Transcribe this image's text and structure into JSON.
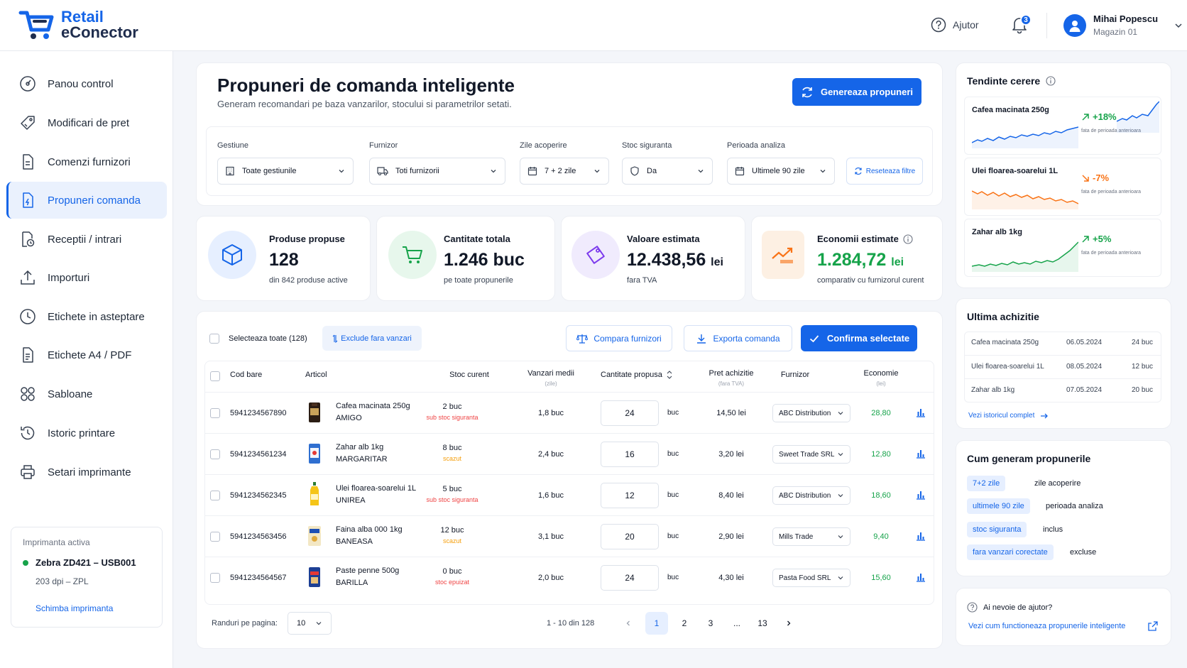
{
  "app": {
    "name_line1": "Retail",
    "name_line2": "eConector"
  },
  "header": {
    "help_label": "Ajutor",
    "notifications_count": "3",
    "user_name": "Mihai Popescu",
    "user_store": "Magazin 01"
  },
  "sidebar": {
    "items": [
      {
        "label": "Panou control",
        "icon": "dashboard-icon"
      },
      {
        "label": "Modificari de pret",
        "icon": "tag-edit-icon"
      },
      {
        "label": "Comenzi furnizori",
        "icon": "document-icon"
      },
      {
        "label": "Propuneri comanda",
        "icon": "document-bolt-icon",
        "active": true
      },
      {
        "label": "Receptii / intrari",
        "icon": "receipt-icon"
      },
      {
        "label": "Importuri",
        "icon": "upload-icon"
      },
      {
        "label": "Etichete in asteptare",
        "icon": "clock-icon"
      },
      {
        "label": "Etichete A4 / PDF",
        "icon": "file-icon"
      },
      {
        "label": "Sabloane",
        "icon": "grid-icon"
      },
      {
        "label": "Istoric printare",
        "icon": "history-icon"
      },
      {
        "label": "Setari imprimante",
        "icon": "printer-icon"
      }
    ],
    "printer": {
      "title": "Imprimanta activa",
      "name": "Zebra ZD421 – USB001",
      "details": "203 dpi – ZPL",
      "change_link": "Schimba imprimanta"
    }
  },
  "page": {
    "title": "Propuneri de comanda inteligente",
    "subtitle": "Generam recomandari pe baza vanzarilor, stocului si parametrilor setati.",
    "generate_button": "Genereaza propuneri"
  },
  "filters": {
    "gestiune": {
      "label": "Gestiune",
      "value": "Toate gestiunile"
    },
    "furnizor": {
      "label": "Furnizor",
      "value": "Toti furnizorii"
    },
    "zile": {
      "label": "Zile acoperire",
      "value": "7 + 2 zile"
    },
    "stoc": {
      "label": "Stoc siguranta",
      "value": "Da"
    },
    "perioada": {
      "label": "Perioada analiza",
      "value": "Ultimele 90 zile"
    },
    "reset": "Reseteaza filtre"
  },
  "stats": {
    "produse": {
      "label": "Produse propuse",
      "value": "128",
      "sub": "din 842 produse active"
    },
    "cantitate": {
      "label": "Cantitate totala",
      "value": "1.246 buc",
      "sub": "pe toate propunerile"
    },
    "valoare": {
      "label": "Valoare estimata",
      "value": "12.438,56",
      "unit": "lei",
      "sub": "fara TVA"
    },
    "economii": {
      "label": "Economii estimate",
      "value": "1.284,72",
      "unit": "lei",
      "sub": "comparativ cu furnizorul curent"
    }
  },
  "table": {
    "select_all": "Selecteaza toate (128)",
    "exclude": "Exclude fara vanzari",
    "compare_button": "Compara furnizori",
    "export_button": "Exporta comanda",
    "confirm_button": "Confirma selectate",
    "headers": {
      "cod": "Cod bare",
      "articol": "Articol",
      "stoc": "Stoc curent",
      "vanzari": "Vanzari medii",
      "vanzari_sub": "(zile)",
      "cantitate": "Cantitate propusa",
      "pret": "Pret achizitie",
      "pret_sub": "(fara TVA)",
      "furnizor": "Furnizor",
      "economie": "Economie",
      "economie_sub": "(lei)"
    },
    "rows": [
      {
        "cod": "5941234567890",
        "name": "Cafea macinata 250g",
        "brand": "AMIGO",
        "stoc": "2 buc",
        "stoc_note": "sub stoc siguranta",
        "note_color": "#ef4444",
        "vanzari": "1,8 buc",
        "qty": "24",
        "unit": "buc",
        "pret": "14,50 lei",
        "furnizor": "ABC Distribution",
        "economie": "28,80"
      },
      {
        "cod": "5941234561234",
        "name": "Zahar alb 1kg",
        "brand": "MARGARITAR",
        "stoc": "8 buc",
        "stoc_note": "scazut",
        "note_color": "#f59e0b",
        "vanzari": "2,4 buc",
        "qty": "16",
        "unit": "buc",
        "pret": "3,20 lei",
        "furnizor": "Sweet Trade SRL",
        "economie": "12,80"
      },
      {
        "cod": "5941234562345",
        "name": "Ulei floarea-soarelui 1L",
        "brand": "UNIREA",
        "stoc": "5 buc",
        "stoc_note": "sub stoc siguranta",
        "note_color": "#ef4444",
        "vanzari": "1,6 buc",
        "qty": "12",
        "unit": "buc",
        "pret": "8,40 lei",
        "furnizor": "ABC Distribution",
        "economie": "18,60"
      },
      {
        "cod": "5941234563456",
        "name": "Faina alba 000 1kg",
        "brand": "BANEASA",
        "stoc": "12 buc",
        "stoc_note": "scazut",
        "note_color": "#f59e0b",
        "vanzari": "3,1 buc",
        "qty": "20",
        "unit": "buc",
        "pret": "2,90 lei",
        "furnizor": "Mills Trade",
        "economie": "9,40"
      },
      {
        "cod": "5941234564567",
        "name": "Paste penne 500g",
        "brand": "BARILLA",
        "stoc": "0 buc",
        "stoc_note": "stoc epuizat",
        "note_color": "#ef4444",
        "vanzari": "2,0 buc",
        "qty": "24",
        "unit": "buc",
        "pret": "4,30 lei",
        "furnizor": "Pasta Food SRL",
        "economie": "15,60"
      }
    ],
    "pagination": {
      "rows_label": "Randuri pe pagina:",
      "rows_value": "10",
      "range": "1 - 10 din 128",
      "pages": [
        "1",
        "2",
        "3",
        "...",
        "13"
      ]
    }
  },
  "trends": {
    "title": "Tendinte cerere",
    "items": [
      {
        "name": "Cafea macinata 250g",
        "pct": "+18%",
        "color": "#16a34a",
        "caption": "fata de perioada anterioara"
      },
      {
        "name": "Ulei floarea-soarelui 1L",
        "pct": "-7%",
        "color": "#f97316",
        "caption": "fata de perioada anterioara"
      },
      {
        "name": "Zahar alb 1kg",
        "pct": "+5%",
        "color": "#16a34a",
        "caption": "fata de perioada anterioara"
      }
    ]
  },
  "last_purchase": {
    "title": "Ultima achizitie",
    "rows": [
      {
        "name": "Cafea macinata 250g",
        "date": "06.05.2024",
        "qty": "24 buc"
      },
      {
        "name": "Ulei floarea-soarelui 1L",
        "date": "08.05.2024",
        "qty": "12 buc"
      },
      {
        "name": "Zahar alb 1kg",
        "date": "07.05.2024",
        "qty": "20 buc"
      }
    ],
    "link": "Vezi istoricul complet"
  },
  "how": {
    "title": "Cum generam propunerile",
    "items": [
      {
        "chip": "7+2 zile",
        "desc": "zile acoperire"
      },
      {
        "chip": "ultimele 90 zile",
        "desc": "perioada analiza"
      },
      {
        "chip": "stoc siguranta",
        "desc": "inclus"
      },
      {
        "chip": "fara vanzari corectate",
        "desc": "excluse"
      }
    ]
  },
  "help_card": {
    "title": "Ai nevoie de ajutor?",
    "link": "Vezi cum functioneaza propunerile inteligente"
  },
  "colors": {
    "accent": "#1565e8",
    "success": "#16a34a",
    "warning": "#f59e0b",
    "danger": "#ef4444"
  }
}
